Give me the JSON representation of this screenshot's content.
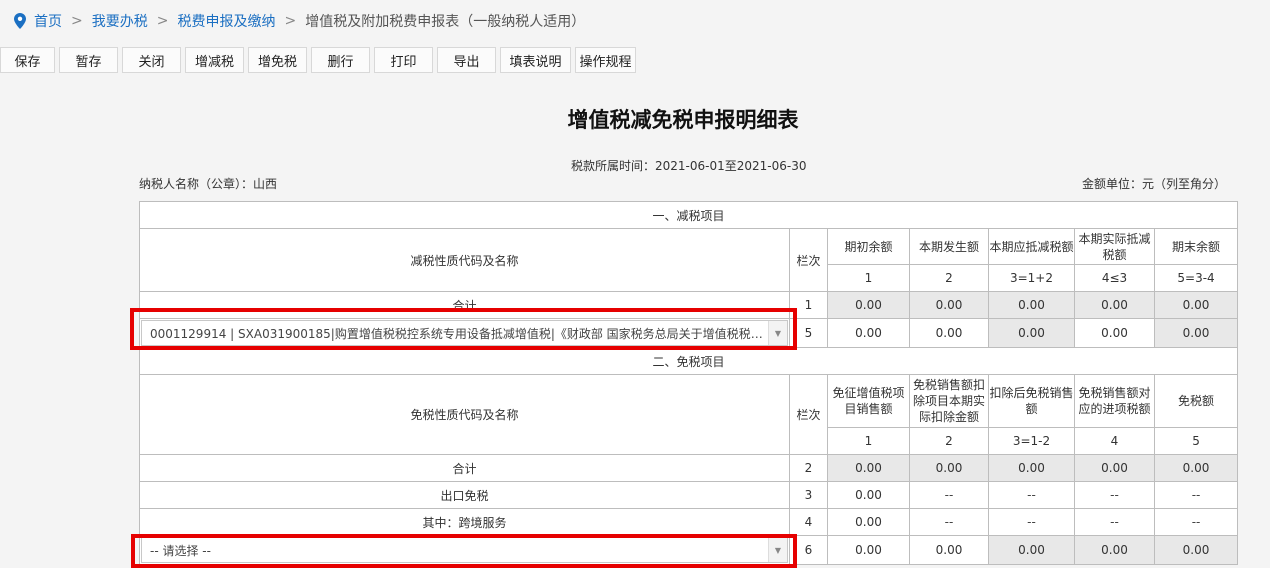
{
  "breadcrumb": {
    "home": "首页",
    "tax": "我要办税",
    "declare": "税费申报及缴纳",
    "current": "增值税及附加税费申报表（一般纳税人适用）",
    "sep": ">"
  },
  "toolbar": [
    "保存",
    "暂存",
    "关闭",
    "增减税",
    "增免税",
    "删行",
    "打印",
    "导出",
    "填表说明",
    "操作规程"
  ],
  "title": "增值税减免税申报明细表",
  "period": "税款所属时间：2021-06-01至2021-06-30",
  "taxpayer": "纳税人名称（公章）：山西",
  "unit": "金额单位：元（列至角分）",
  "reduction": {
    "section_title": "一、减税项目",
    "name_header": "减税性质代码及名称",
    "line_header": "栏次",
    "col_headers": [
      "期初余额",
      "本期发生额",
      "本期应抵减税额",
      "本期实际抵减税额",
      "期末余额"
    ],
    "col_formulas": [
      "1",
      "2",
      "3=1+2",
      "4≤3",
      "5=3-4"
    ],
    "total_row": {
      "label": "合计",
      "line": "1",
      "values": [
        "0.00",
        "0.00",
        "0.00",
        "0.00",
        "0.00"
      ]
    },
    "item_row": {
      "select_value": "0001129914 | SXA031900185|购置增值税税控系统专用设备抵减增值税|《财政部 国家税务总局关于增值税税控...",
      "line": "5",
      "values": [
        "0.00",
        "0.00",
        "0.00",
        "0.00",
        "0.00"
      ]
    }
  },
  "exemption": {
    "section_title": "二、免税项目",
    "name_header": "免税性质代码及名称",
    "line_header": "栏次",
    "col_headers": [
      "免征增值税项目销售额",
      "免税销售额扣除项目本期实际扣除金额",
      "扣除后免税销售额",
      "免税销售额对应的进项税额",
      "免税额"
    ],
    "col_formulas": [
      "1",
      "2",
      "3=1-2",
      "4",
      "5"
    ],
    "total_row": {
      "label": "合计",
      "line": "2",
      "values": [
        "0.00",
        "0.00",
        "0.00",
        "0.00",
        "0.00"
      ]
    },
    "export_row": {
      "label": "出口免税",
      "line": "3",
      "values": [
        "0.00",
        "--",
        "--",
        "--",
        "--"
      ]
    },
    "crossborder_row": {
      "label": "其中：跨境服务",
      "line": "4",
      "values": [
        "0.00",
        "--",
        "--",
        "--",
        "--"
      ]
    },
    "item_row": {
      "select_value": "-- 请选择 --",
      "line": "6",
      "values": [
        "0.00",
        "0.00",
        "0.00",
        "0.00",
        "0.00"
      ]
    }
  },
  "colors": {
    "link": "#1b6fc2",
    "highlight": "#e60000",
    "gray_cell": "#e8e8e8"
  }
}
